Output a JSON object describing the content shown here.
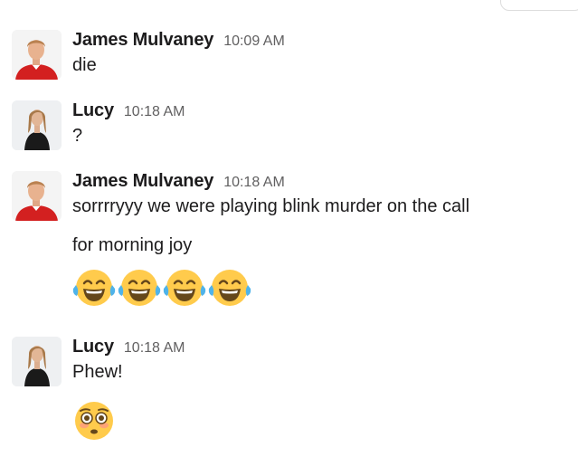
{
  "messages": [
    {
      "sender": "James Mulvaney",
      "time": "10:09 AM",
      "lines": [
        "die"
      ]
    },
    {
      "sender": "Lucy",
      "time": "10:18 AM",
      "lines": [
        "?"
      ]
    },
    {
      "sender": "James Mulvaney",
      "time": "10:18 AM",
      "lines": [
        "sorrrryyy we were playing blink murder on the call",
        "for morning joy"
      ],
      "emojis": [
        "face-with-tears-of-joy",
        "face-with-tears-of-joy",
        "face-with-tears-of-joy",
        "face-with-tears-of-joy"
      ]
    },
    {
      "sender": "Lucy",
      "time": "10:18 AM",
      "lines": [
        "Phew!"
      ],
      "emojis": [
        "flushed-face"
      ]
    }
  ],
  "colors": {
    "name": "#1d1c1d",
    "timestamp": "#616061",
    "emoji_face": "#ffcb4c",
    "tears": "#4fb3ea"
  }
}
